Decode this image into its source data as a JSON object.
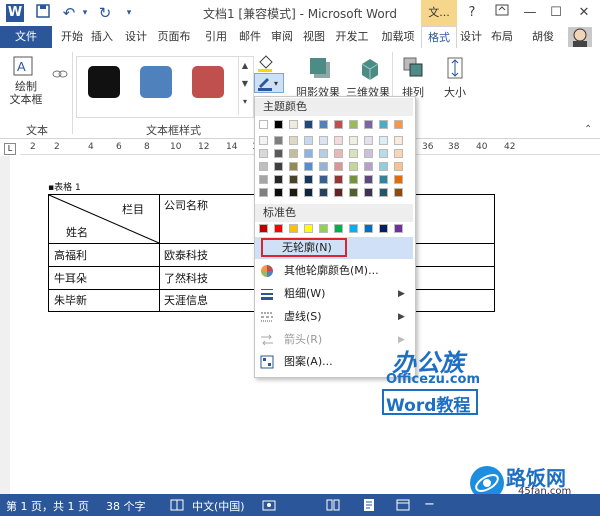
{
  "window": {
    "title": "文档1 [兼容模式] - Microsoft Word",
    "context_tab_top": "文...",
    "help": "?",
    "min": "—",
    "max": "☐",
    "close": "✕"
  },
  "quick_access": {
    "word_icon": "W",
    "save": "💾",
    "undo": "↶",
    "undo_arrow": "▾",
    "redo": "↻",
    "customize": "▾"
  },
  "tabs": [
    "文件",
    "开始",
    "插入",
    "设计",
    "页面布",
    "引用",
    "邮件",
    "审阅",
    "视图",
    "开发工",
    "加载项",
    "格式",
    "设计",
    "布局"
  ],
  "user": "胡俊",
  "ribbon": {
    "draw_textbox": "绘制\n文本框",
    "group_text": "文本",
    "group_textbox_styles": "文本框样式",
    "shadow_effects": "阴影效果",
    "three_d_effects": "三维效果",
    "arrange": "排列",
    "size": "大小",
    "style_colors": [
      "#111111",
      "#4f81bd",
      "#c0504d"
    ]
  },
  "ruler_ticks": [
    "2",
    "2",
    "4",
    "6",
    "8",
    "10",
    "12",
    "14",
    "16",
    "18",
    "20",
    "22",
    "24",
    "36",
    "38",
    "40",
    "42"
  ],
  "document": {
    "caption": "表格 1",
    "header_col1_top": "栏目",
    "header_col1_bottom": "姓名",
    "header_col2": "公司名称",
    "rows": [
      {
        "name": "高福利",
        "company": "欧泰科技"
      },
      {
        "name": "牛耳朵",
        "company": "了然科技"
      },
      {
        "name": "朱毕新",
        "company": "天涯信息"
      }
    ]
  },
  "menu": {
    "theme_colors_label": "主题颜色",
    "standard_colors_label": "标准色",
    "theme_row": [
      "#ffffff",
      "#000000",
      "#eeece1",
      "#1f497d",
      "#4f81bd",
      "#c0504d",
      "#9bbb59",
      "#8064a2",
      "#4bacc6",
      "#f79646"
    ],
    "theme_shades": [
      [
        "#f2f2f2",
        "#7f7f7f",
        "#ddd9c3",
        "#c6d9f0",
        "#dbe5f1",
        "#f2dcdb",
        "#ebf1dd",
        "#e5e0ec",
        "#dbeef3",
        "#fdeada"
      ],
      [
        "#d8d8d8",
        "#595959",
        "#c4bd97",
        "#8db3e2",
        "#b8cce4",
        "#e5b9b7",
        "#d7e3bc",
        "#ccc1d9",
        "#b7dde8",
        "#fbd5b5"
      ],
      [
        "#bfbfbf",
        "#3f3f3f",
        "#938953",
        "#548dd4",
        "#95b3d7",
        "#d99694",
        "#c3d69b",
        "#b2a2c7",
        "#92cddc",
        "#fac08f"
      ],
      [
        "#a5a5a5",
        "#262626",
        "#494429",
        "#17365d",
        "#366092",
        "#953734",
        "#76923c",
        "#5f497a",
        "#31859b",
        "#e36c09"
      ],
      [
        "#7f7f7f",
        "#0c0c0c",
        "#1d1b10",
        "#0f243e",
        "#244061",
        "#632423",
        "#4f6128",
        "#3f3151",
        "#205867",
        "#974806"
      ]
    ],
    "standard_row": [
      "#c00000",
      "#ff0000",
      "#ffc000",
      "#ffff00",
      "#92d050",
      "#00b050",
      "#00b0f0",
      "#0070c0",
      "#002060",
      "#7030a0"
    ],
    "no_outline": "无轮廓(N)",
    "more_colors": "其他轮廓颜色(M)...",
    "weight": "粗细(W)",
    "dashes": "虚线(S)",
    "arrows": "箭头(R)",
    "pattern": "图案(A)..."
  },
  "status": {
    "page": "第 1 页，共 1 页",
    "words": "38 个字",
    "language": "中文(中国)"
  },
  "watermark": {
    "brand": "办公族",
    "domain": "Officezu.com",
    "word_tutorial": "Word教程",
    "site_name": "路饭网",
    "site_domain": "45fan.com"
  }
}
